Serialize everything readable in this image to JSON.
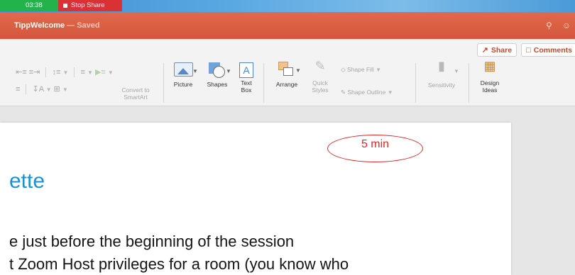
{
  "zoom_bar": {
    "timer": "03:38",
    "stop_share_label": "Stop Share"
  },
  "titlebar": {
    "doc_name": "TippWelcome",
    "status": " — Saved"
  },
  "ribbon": {
    "share_label": "Share",
    "comments_label": "Comments",
    "convert_smartart": [
      "Convert to",
      "SmartArt"
    ],
    "picture": "Picture",
    "shapes": "Shapes",
    "text_box": [
      "Text",
      "Box"
    ],
    "arrange": "Arrange",
    "quick_styles": [
      "Quick",
      "Styles"
    ],
    "shape_fill": "Shape Fill",
    "shape_outline": "Shape Outline",
    "sensitivity": "Sensitivity",
    "design_ideas": [
      "Design",
      "Ideas"
    ]
  },
  "slide": {
    "timer_annotation": "5 min",
    "heading": "ette",
    "lines": [
      "e just before the beginning of the session",
      "t Zoom Host privileges for a room (you know who"
    ]
  },
  "colors": {
    "accent": "#d3573c",
    "heading_blue": "#1e90d7",
    "annotation_red": "#d8282b",
    "zoom_green": "#22b34a",
    "zoom_red": "#d93134"
  },
  "icons": [
    "search-icon",
    "smiley-icon",
    "share-icon",
    "comment-icon",
    "picture-icon",
    "shapes-icon",
    "text-box-icon",
    "arrange-icon",
    "quick-styles-icon",
    "shape-fill-icon",
    "shape-outline-icon",
    "sensitivity-icon",
    "design-ideas-icon"
  ]
}
